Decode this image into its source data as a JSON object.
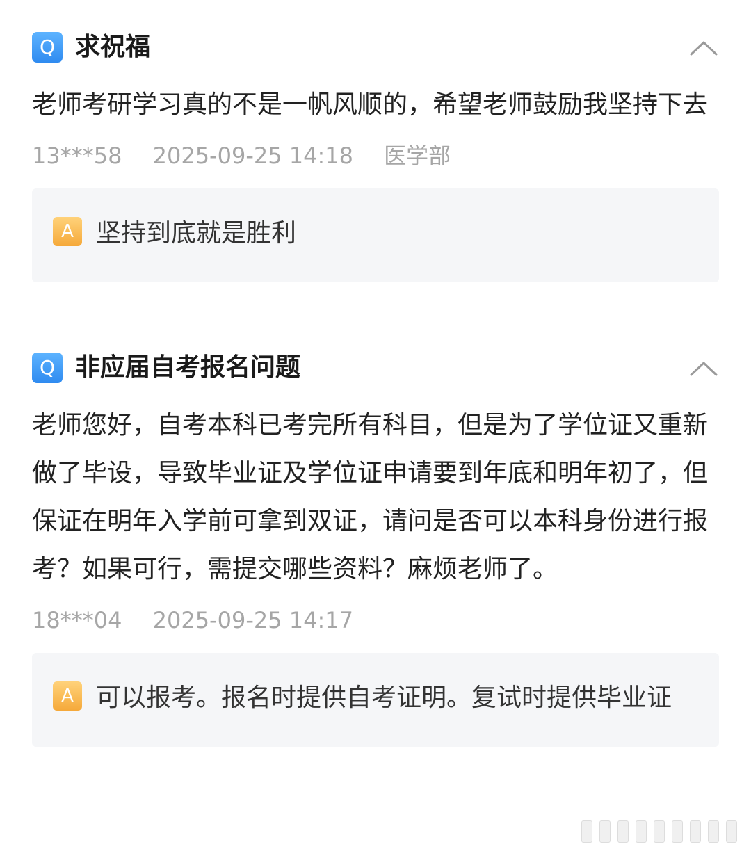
{
  "questions": [
    {
      "badge": "Q",
      "title": "求祝福",
      "body": "老师考研学习真的不是一帆风顺的，希望老师鼓励我坚持下去",
      "user": "13***58",
      "datetime": "2025-09-25 14:18",
      "department": "医学部",
      "answer_badge": "A",
      "answer": "坚持到底就是胜利"
    },
    {
      "badge": "Q",
      "title": "非应届自考报名问题",
      "body": "老师您好，自考本科已考完所有科目，但是为了学位证又重新做了毕设，导致毕业证及学位证申请要到年底和明年初了，但保证在明年入学前可拿到双证，请问是否可以本科身份进行报考？如果可行，需提交哪些资料？麻烦老师了。",
      "user": "18***04",
      "datetime": "2025-09-25 14:17",
      "department": "",
      "answer_badge": "A",
      "answer": "可以报考。报名时提供自考证明。复试时提供毕业证"
    }
  ],
  "icons": {
    "collapse": "chevron-up-icon"
  },
  "colors": {
    "q_badge": "#3a96f5",
    "a_badge": "#f7b24a",
    "meta_text": "#a6a6a6",
    "answer_bg": "#f5f6f8"
  }
}
